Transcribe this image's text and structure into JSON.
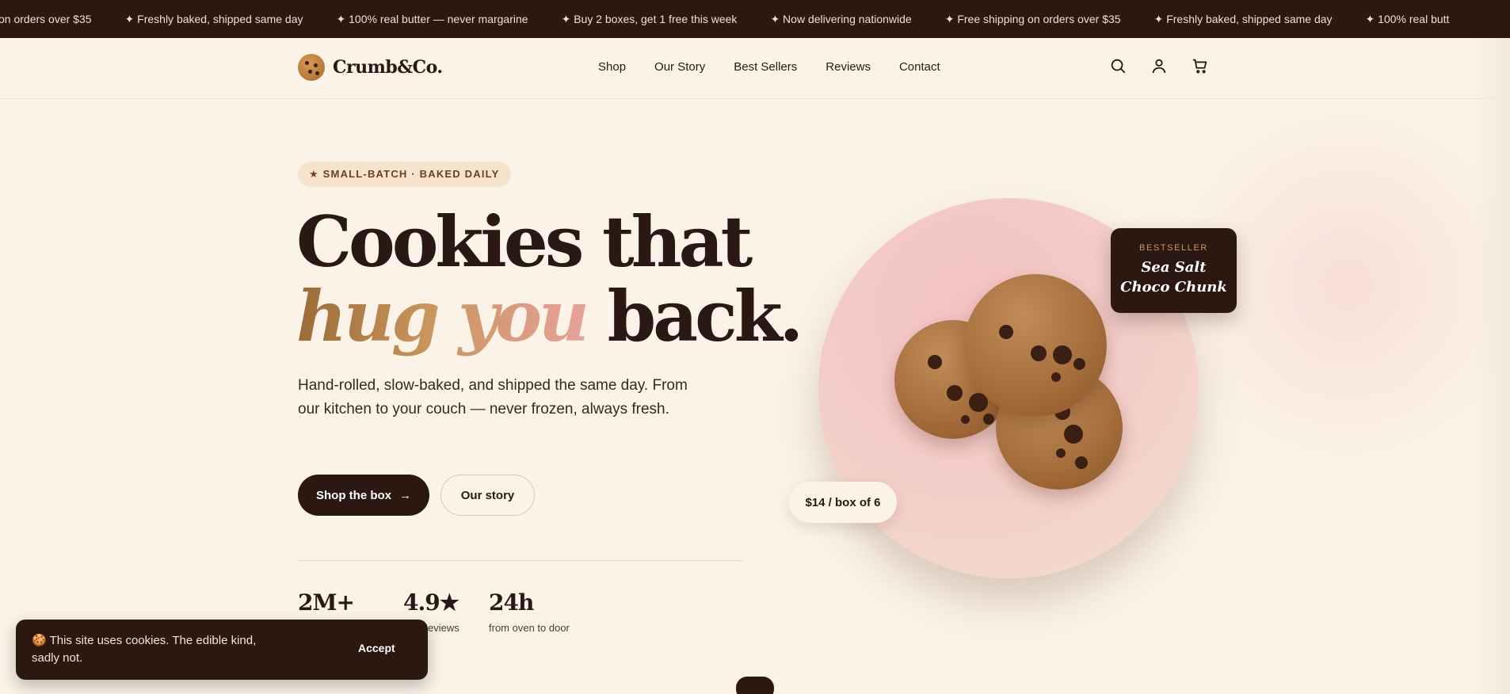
{
  "announcement": {
    "items": [
      "on orders over $35",
      "✦ Freshly baked, shipped same day",
      "✦ 100% real butter — never margarine",
      "✦ Buy 2 boxes, get 1 free this week",
      "✦ Now delivering nationwide",
      "✦ Free shipping on orders over $35",
      "✦ Freshly baked, shipped same day",
      "✦ 100% real butt"
    ]
  },
  "header": {
    "brand": "Crumb&Co.",
    "nav": [
      "Shop",
      "Our Story",
      "Best Sellers",
      "Reviews",
      "Contact"
    ],
    "icons": [
      "search-icon",
      "user-icon",
      "cart-icon"
    ]
  },
  "hero": {
    "badge": "★ SMALL-BATCH · BAKED DAILY",
    "title_line1": "Cookies that",
    "title_accent": "hug you",
    "title_line2_end": "back.",
    "subtitle": "Hand-rolled, slow-baked, and shipped the same day. From our kitchen to your couch — never frozen, always fresh.",
    "primary_cta": "Shop the box",
    "primary_arrow": "→",
    "secondary_cta": "Our story",
    "stats": [
      {
        "value": "2M+",
        "label": ""
      },
      {
        "value": "4.9★",
        "label": "eviews"
      },
      {
        "value": "24h",
        "label": "from oven to door"
      }
    ]
  },
  "product": {
    "card_tag": "BESTSELLER",
    "card_name_line1": "Sea Salt",
    "card_name_line2": "Choco Chunk",
    "price": "$14 / box of 6"
  },
  "cookie_banner": {
    "text": "🍪 This site uses cookies. The edible kind, sadly not.",
    "accept": "Accept"
  },
  "colors": {
    "background": "#fbf3e8",
    "dark": "#2a1811",
    "accent_gold": "#c8955d",
    "accent_pink": "#f2c2c3"
  }
}
